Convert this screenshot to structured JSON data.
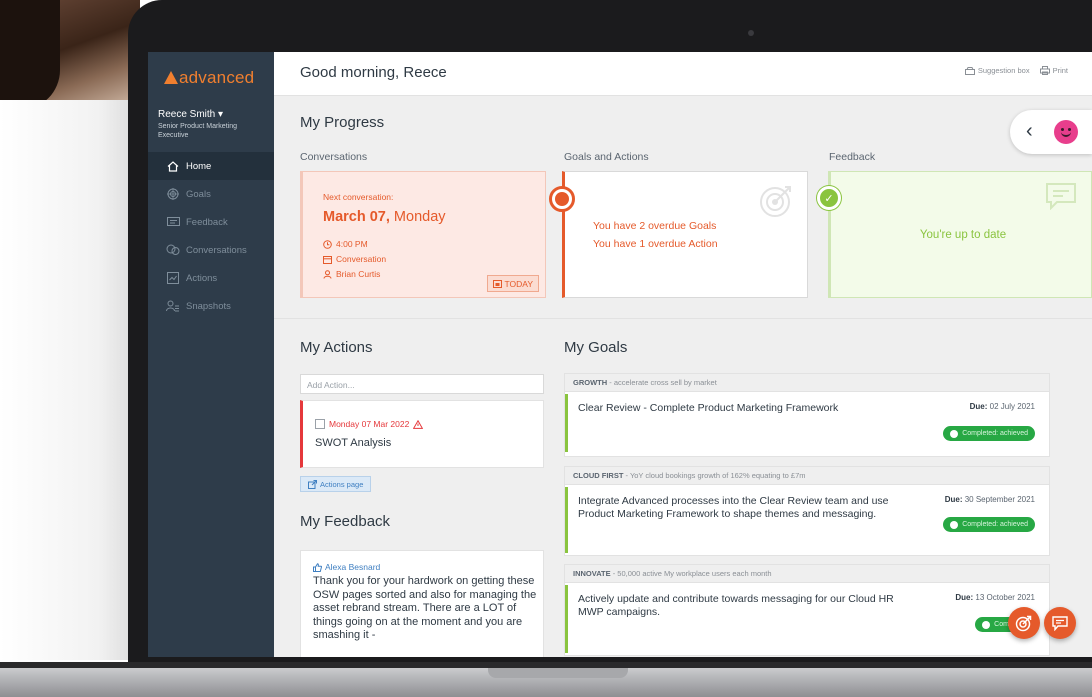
{
  "brand": {
    "name": "advanced"
  },
  "user": {
    "name": "Reece Smith ▾",
    "role": "Senior Product Marketing Executive"
  },
  "sidebar": {
    "items": [
      {
        "label": "Home",
        "icon": "home-icon",
        "active": true
      },
      {
        "label": "Goals",
        "icon": "target-icon",
        "active": false
      },
      {
        "label": "Feedback",
        "icon": "feedback-icon",
        "active": false
      },
      {
        "label": "Conversations",
        "icon": "conversations-icon",
        "active": false
      },
      {
        "label": "Actions",
        "icon": "actions-icon",
        "active": false
      },
      {
        "label": "Snapshots",
        "icon": "snapshots-icon",
        "active": false
      }
    ]
  },
  "header": {
    "greeting": "Good morning, Reece",
    "suggestion_label": "Suggestion box",
    "print_label": "Print"
  },
  "progress": {
    "title": "My Progress",
    "conversations": {
      "label": "Conversations",
      "next_label": "Next conversation:",
      "date_bold": "March 07,",
      "date_day": " Monday",
      "time": "4:00 PM",
      "type": "Conversation",
      "person": "Brian Curtis",
      "today_label": "TODAY"
    },
    "goals": {
      "label": "Goals and Actions",
      "overdue_goals": "You have 2 overdue Goals",
      "overdue_actions": "You have 1 overdue Action"
    },
    "feedback": {
      "label": "Feedback",
      "status": "You're up to date"
    }
  },
  "actions": {
    "title": "My Actions",
    "add_placeholder": "Add Action...",
    "items": [
      {
        "date": "Monday 07 Mar 2022",
        "title": "SWOT Analysis"
      }
    ],
    "page_button": "Actions page"
  },
  "my_feedback": {
    "title": "My Feedback",
    "items": [
      {
        "author": "Alexa Besnard",
        "body": "Thank you for your hardwork on getting these OSW pages sorted and also for managing the asset rebrand stream. There are a LOT of things going on at the moment and you are smashing it -"
      }
    ]
  },
  "goals": {
    "title": "My Goals",
    "groups": [
      {
        "head_bold": "GROWTH",
        "head_rest": " - accelerate cross sell by market",
        "desc": "Clear Review - Complete Product Marketing Framework",
        "due_label": "Due:",
        "due_date": " 02 July 2021",
        "status": "Completed: achieved"
      },
      {
        "head_bold": "CLOUD FIRST",
        "head_rest": " - YoY cloud bookings growth of 162% equating to £7m",
        "desc": "Integrate Advanced processes into the Clear Review team and use Product Marketing Framework to shape themes and messaging.",
        "due_label": "Due:",
        "due_date": " 30 September 2021",
        "status": "Completed: achieved"
      },
      {
        "head_bold": "INNOVATE",
        "head_rest": " - 50,000 active My workplace users each month",
        "desc": "Actively update and contribute towards messaging for our Cloud HR MWP campaigns.",
        "due_label": "Due:",
        "due_date": " 13 October 2021",
        "status": "Completed"
      }
    ]
  },
  "colors": {
    "sidebar_bg": "#2e3c4a",
    "accent_orange": "#e55a2b",
    "accent_green": "#8ac43f",
    "status_green": "#27a844",
    "smiley_pink": "#e83e8c"
  }
}
